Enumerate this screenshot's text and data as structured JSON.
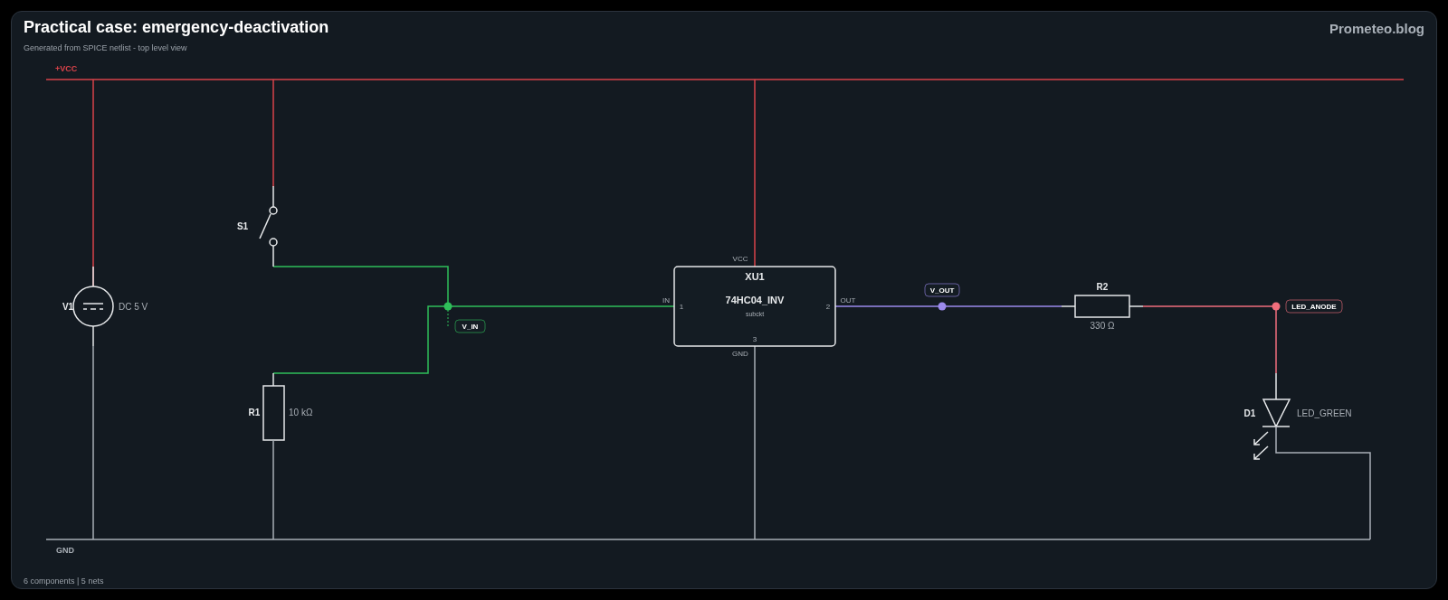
{
  "header": {
    "title": "Practical case: emergency-deactivation",
    "subtitle": "Generated from SPICE netlist - top level view",
    "brand": "Prometeo.blog"
  },
  "rails": [
    {
      "kind": "supply",
      "label": "+VCC"
    },
    {
      "kind": "ground",
      "label": "GND"
    }
  ],
  "components": [
    {
      "kind": "source",
      "ref": "V1",
      "value": "DC 5 V"
    },
    {
      "kind": "switch",
      "ref": "S1"
    },
    {
      "kind": "resistor",
      "ref": "R1",
      "value": "10 kΩ"
    },
    {
      "kind": "ic",
      "ref": "XU1",
      "value": "74HC04_INV",
      "subtitle": "subckt",
      "pin_numbers": [
        "1",
        "2",
        "3"
      ],
      "pin_names": [
        "VCC",
        "IN",
        "OUT",
        "GND"
      ]
    },
    {
      "kind": "resistor",
      "ref": "R2",
      "value": "330 Ω"
    },
    {
      "kind": "led",
      "ref": "D1",
      "value": "LED_GREEN"
    }
  ],
  "nets": [
    {
      "label": "V_IN",
      "color": "#2fbf5a"
    },
    {
      "label": "V_OUT",
      "color": "#9b8aec"
    },
    {
      "label": "LED_ANODE",
      "color": "#f06e7c"
    }
  ],
  "footer": "6 components | 5 nets"
}
